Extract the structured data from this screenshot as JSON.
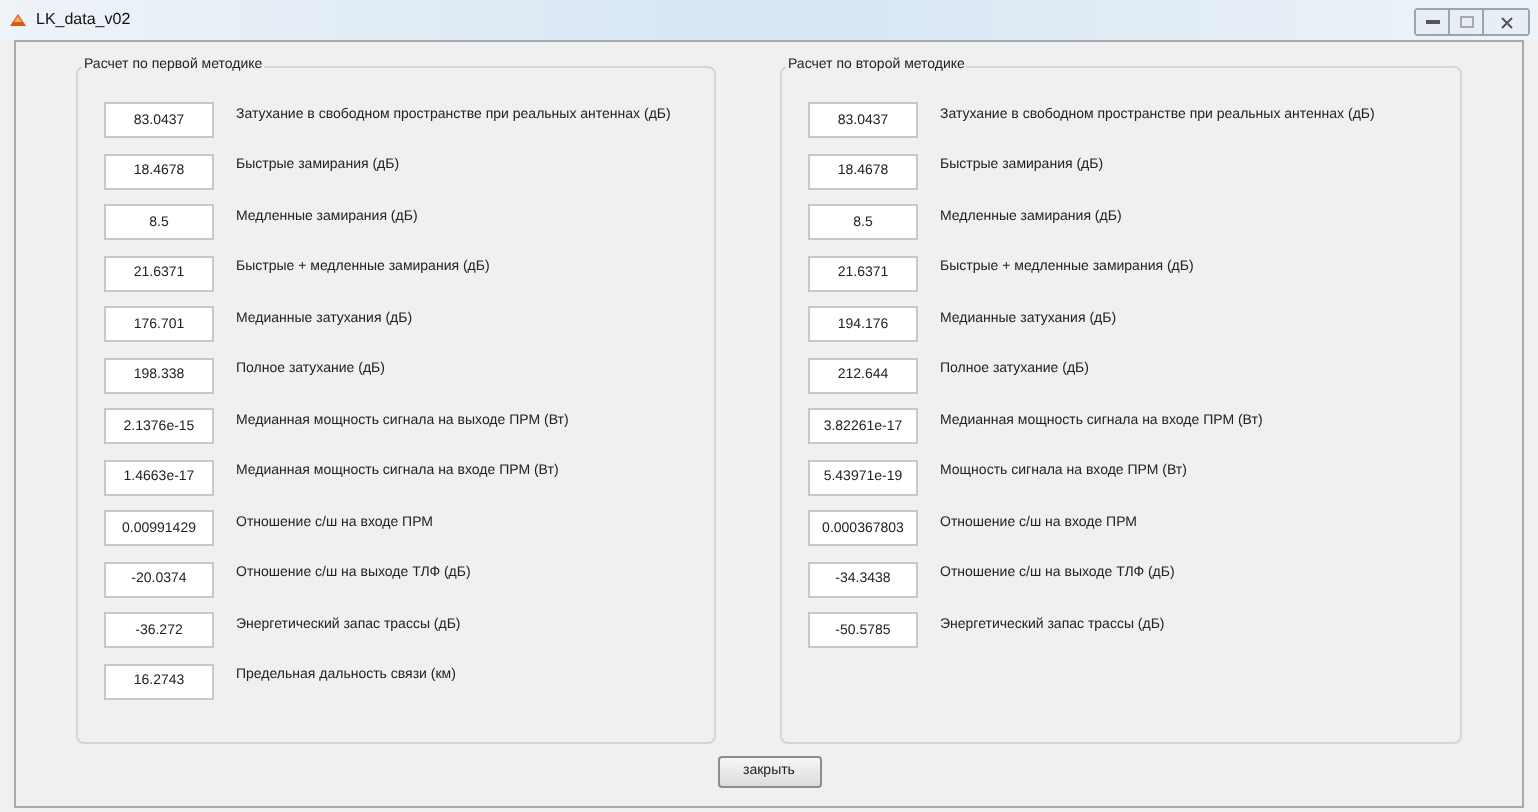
{
  "window": {
    "title": "LK_data_v02"
  },
  "panels": [
    {
      "title": "Расчет по первой методике",
      "rows": [
        {
          "value": "83.0437",
          "label": "Затухание в свободном пространстве при реальных антеннах (дБ)"
        },
        {
          "value": "18.4678",
          "label": "Быстрые замирания (дБ)"
        },
        {
          "value": "8.5",
          "label": "Медленные замирания  (дБ)"
        },
        {
          "value": "21.6371",
          "label": "Быстрые + медленные замирания (дБ)"
        },
        {
          "value": "176.701",
          "label": "Медианные затухания (дБ)"
        },
        {
          "value": "198.338",
          "label": "Полное затухание (дБ)"
        },
        {
          "value": "2.1376e-15",
          "label": "Медианная мощность сигнала на выходе ПРМ (Вт)"
        },
        {
          "value": "1.4663e-17",
          "label": "Медианная мощность сигнала на входе ПРМ (Вт)"
        },
        {
          "value": "0.00991429",
          "label": "Отношение с/ш на входе ПРМ"
        },
        {
          "value": "-20.0374",
          "label": "Отношение с/ш на выходе ТЛФ (дБ)"
        },
        {
          "value": "-36.272",
          "label": "Энергетический запас трассы (дБ)"
        },
        {
          "value": "16.2743",
          "label": "Предельная дальность связи (км)"
        }
      ]
    },
    {
      "title": "Расчет по второй методике",
      "rows": [
        {
          "value": "83.0437",
          "label": "Затухание в свободном пространстве при реальных антеннах (дБ)"
        },
        {
          "value": "18.4678",
          "label": "Быстрые замирания (дБ)"
        },
        {
          "value": "8.5",
          "label": "Медленные замирания  (дБ)"
        },
        {
          "value": "21.6371",
          "label": "Быстрые + медленные замирания (дБ)"
        },
        {
          "value": "194.176",
          "label": "Медианные затухания (дБ)"
        },
        {
          "value": "212.644",
          "label": "Полное затухание (дБ)"
        },
        {
          "value": "3.82261e-17",
          "label": "Медианная мощность сигнала на входе ПРМ (Вт)"
        },
        {
          "value": "5.43971e-19",
          "label": "Мощность сигнала на входе  ПРМ (Вт)"
        },
        {
          "value": "0.000367803",
          "label": "Отношение с/ш на входе ПРМ"
        },
        {
          "value": "-34.3438",
          "label": "Отношение с/ш на выходе ТЛФ (дБ)"
        },
        {
          "value": "-50.5785",
          "label": "Энергетический запас трассы (дБ)"
        }
      ]
    }
  ],
  "close_button": "закрыть"
}
